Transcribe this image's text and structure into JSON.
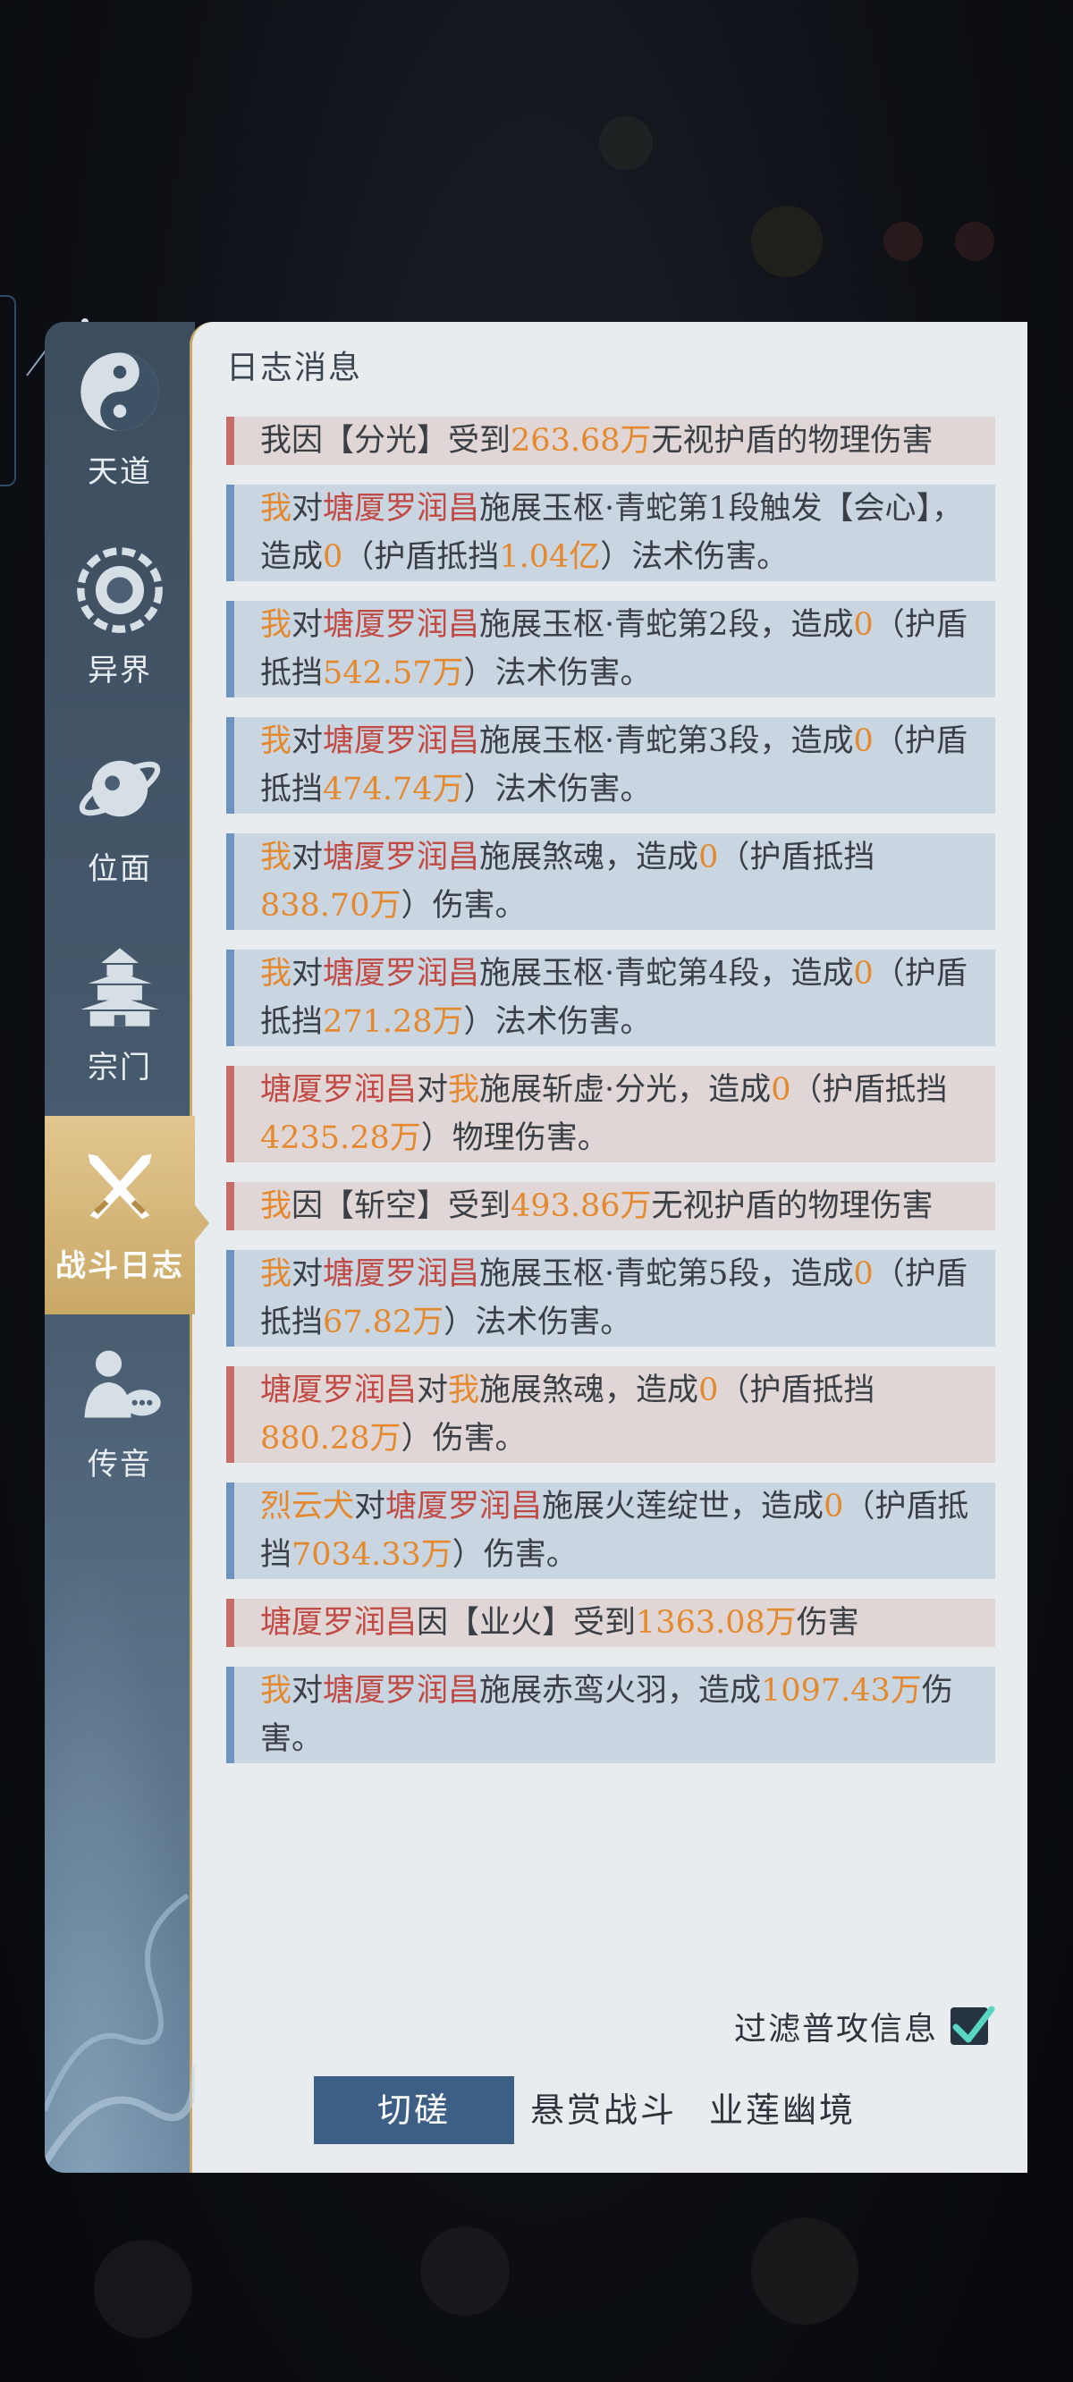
{
  "sidebar": {
    "items": [
      {
        "label": "天道",
        "icon": "yin-yang-icon"
      },
      {
        "label": "异界",
        "icon": "portal-icon"
      },
      {
        "label": "位面",
        "icon": "planet-icon"
      },
      {
        "label": "宗门",
        "icon": "pagoda-icon"
      },
      {
        "label": "战斗日志",
        "icon": "crossed-swords-icon"
      },
      {
        "label": "传音",
        "icon": "chat-person-icon"
      }
    ],
    "active_index": 4
  },
  "panel": {
    "title": "日志消息"
  },
  "log_entries": [
    {
      "type": "red",
      "segments": [
        [
          "n",
          "我"
        ],
        [
          "n",
          "因【分光】受到"
        ],
        [
          "o",
          "263.68万"
        ],
        [
          "n",
          "无视护盾的物理伤害"
        ]
      ]
    },
    {
      "type": "blue",
      "segments": [
        [
          "o",
          "我"
        ],
        [
          "n",
          "对"
        ],
        [
          "r",
          "塘厦罗润昌"
        ],
        [
          "n",
          "施展玉枢·青蛇第1段触发【会心】，造成"
        ],
        [
          "o",
          "0"
        ],
        [
          "n",
          "（护盾抵挡"
        ],
        [
          "o",
          "1.04亿"
        ],
        [
          "n",
          "）法术伤害。"
        ]
      ]
    },
    {
      "type": "blue",
      "segments": [
        [
          "o",
          "我"
        ],
        [
          "n",
          "对"
        ],
        [
          "r",
          "塘厦罗润昌"
        ],
        [
          "n",
          "施展玉枢·青蛇第2段，造成"
        ],
        [
          "o",
          "0"
        ],
        [
          "n",
          "（护盾抵挡"
        ],
        [
          "o",
          "542.57万"
        ],
        [
          "n",
          "）法术伤害。"
        ]
      ]
    },
    {
      "type": "blue",
      "segments": [
        [
          "o",
          "我"
        ],
        [
          "n",
          "对"
        ],
        [
          "r",
          "塘厦罗润昌"
        ],
        [
          "n",
          "施展玉枢·青蛇第3段，造成"
        ],
        [
          "o",
          "0"
        ],
        [
          "n",
          "（护盾抵挡"
        ],
        [
          "o",
          "474.74万"
        ],
        [
          "n",
          "）法术伤害。"
        ]
      ]
    },
    {
      "type": "blue",
      "segments": [
        [
          "o",
          "我"
        ],
        [
          "n",
          "对"
        ],
        [
          "r",
          "塘厦罗润昌"
        ],
        [
          "n",
          "施展煞魂，造成"
        ],
        [
          "o",
          "0"
        ],
        [
          "n",
          "（护盾抵挡"
        ],
        [
          "o",
          "838.70万"
        ],
        [
          "n",
          "）伤害。"
        ]
      ]
    },
    {
      "type": "blue",
      "segments": [
        [
          "o",
          "我"
        ],
        [
          "n",
          "对"
        ],
        [
          "r",
          "塘厦罗润昌"
        ],
        [
          "n",
          "施展玉枢·青蛇第4段，造成"
        ],
        [
          "o",
          "0"
        ],
        [
          "n",
          "（护盾抵挡"
        ],
        [
          "o",
          "271.28万"
        ],
        [
          "n",
          "）法术伤害。"
        ]
      ]
    },
    {
      "type": "red",
      "segments": [
        [
          "r",
          "塘厦罗润昌"
        ],
        [
          "n",
          "对"
        ],
        [
          "o",
          "我"
        ],
        [
          "n",
          "施展斩虚·分光，造成"
        ],
        [
          "o",
          "0"
        ],
        [
          "n",
          "（护盾抵挡"
        ],
        [
          "o",
          "4235.28万"
        ],
        [
          "n",
          "）物理伤害。"
        ]
      ]
    },
    {
      "type": "red",
      "segments": [
        [
          "o",
          "我"
        ],
        [
          "n",
          "因【斩空】受到"
        ],
        [
          "o",
          "493.86万"
        ],
        [
          "n",
          "无视护盾的物理伤害"
        ]
      ]
    },
    {
      "type": "blue",
      "segments": [
        [
          "o",
          "我"
        ],
        [
          "n",
          "对"
        ],
        [
          "r",
          "塘厦罗润昌"
        ],
        [
          "n",
          "施展玉枢·青蛇第5段，造成"
        ],
        [
          "o",
          "0"
        ],
        [
          "n",
          "（护盾抵挡"
        ],
        [
          "o",
          "67.82万"
        ],
        [
          "n",
          "）法术伤害。"
        ]
      ]
    },
    {
      "type": "red",
      "segments": [
        [
          "r",
          "塘厦罗润昌"
        ],
        [
          "n",
          "对"
        ],
        [
          "o",
          "我"
        ],
        [
          "n",
          "施展煞魂，造成"
        ],
        [
          "o",
          "0"
        ],
        [
          "n",
          "（护盾抵挡"
        ],
        [
          "o",
          "880.28万"
        ],
        [
          "n",
          "）伤害。"
        ]
      ]
    },
    {
      "type": "blue",
      "segments": [
        [
          "o",
          "烈云犬"
        ],
        [
          "n",
          "对"
        ],
        [
          "r",
          "塘厦罗润昌"
        ],
        [
          "n",
          "施展火莲绽世，造成"
        ],
        [
          "o",
          "0"
        ],
        [
          "n",
          "（护盾抵挡"
        ],
        [
          "o",
          "7034.33万"
        ],
        [
          "n",
          "）伤害。"
        ]
      ]
    },
    {
      "type": "red",
      "segments": [
        [
          "r",
          "塘厦罗润昌"
        ],
        [
          "n",
          "因【业火】受到"
        ],
        [
          "o",
          "1363.08万"
        ],
        [
          "n",
          "伤害"
        ]
      ]
    },
    {
      "type": "blue",
      "segments": [
        [
          "o",
          "我"
        ],
        [
          "n",
          "对"
        ],
        [
          "r",
          "塘厦罗润昌"
        ],
        [
          "n",
          "施展赤鸾火羽，造成"
        ],
        [
          "o",
          "1097.43万"
        ],
        [
          "n",
          "伤害。"
        ]
      ]
    }
  ],
  "filter": {
    "label": "过滤普攻信息",
    "checked": true
  },
  "tabs": [
    {
      "label": "切磋",
      "active": true
    },
    {
      "label": "悬赏战斗",
      "active": false
    },
    {
      "label": "业莲幽境",
      "active": false
    }
  ],
  "colors": {
    "highlight_orange": "#e4892e",
    "enemy_red": "#c24a44",
    "active_tab": "#3d5f86",
    "sidebar_active": "#d4b478"
  }
}
